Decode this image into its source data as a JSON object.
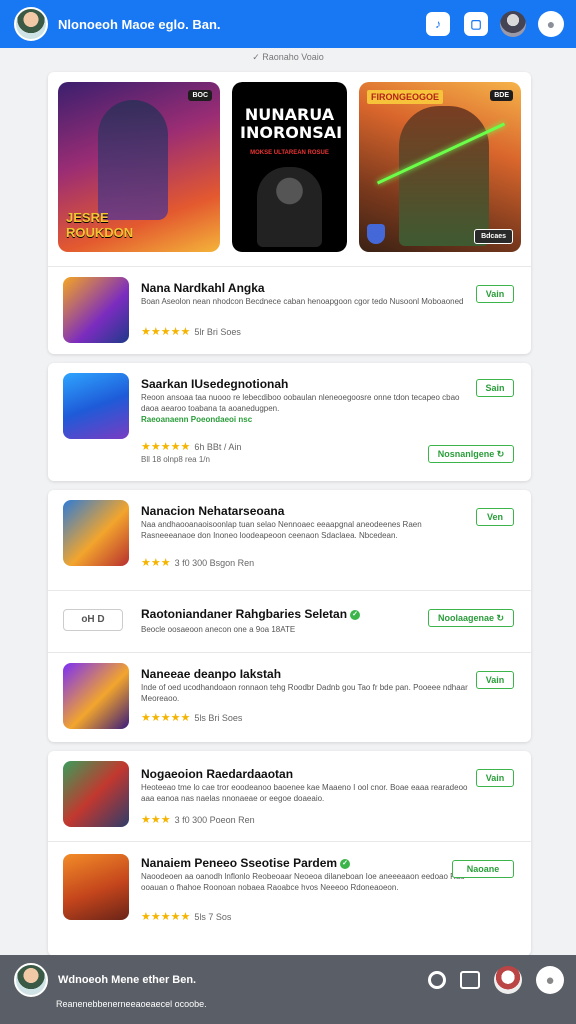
{
  "header": {
    "title": "Nlonoeoh Maoe eglo. Ban.",
    "icons": [
      "music-icon",
      "square-icon",
      "profile-avatar",
      "user-icon"
    ]
  },
  "subbar": {
    "text": "✓ Raonaho Voaio"
  },
  "banners": [
    {
      "tag": "BOC",
      "title_line1": "JESRE",
      "title_line2": "ROUKDON"
    },
    {
      "title": "NUNARUA INORONSAI",
      "subtitle": "MOKSE ULTAREAN ROSUE"
    },
    {
      "sign": "FIRONGEOGOE",
      "tag": "BDE",
      "button": "Bdcaes"
    }
  ],
  "apps_group1": [
    {
      "title": "Nana Nardkahl Angka",
      "desc": "Boan Aseolon nean nhodcon Becdnece caban henoapgoon cgor tedo Nusoonl Moboaoned",
      "rating_text": "5lr Bri Soes",
      "button": "Vain"
    }
  ],
  "apps_group2": [
    {
      "title": "Saarkan IUsedegnotionah",
      "desc": "Reoon ansoaa taa nuooo re lebecdiboo oobaulan nleneoegoosre onne tdon tecapeo cbao daoa aearoo toabana ta aoanedugpen.",
      "desc_green": "Raeoanaenn Poeondaeoi nsc",
      "rating_text": "6h BBt   / Ain",
      "rating_text2": "Bll  18 olnp8 rea 1/n",
      "button": "Sain",
      "button2": "Nosnanlgene"
    }
  ],
  "apps_group3": [
    {
      "title": "Nanacion Nehatarseoana",
      "desc": "Naa andhaooanaoisoonlap tuan selao Nennoaec eeaapgnal aneodeenes Raen Rasneeeanaoe don Inoneo loodeapeoon ceenaon Sdaclaea. Nbcedean.",
      "rating_text": "3 f0  300  Bsgon Ren",
      "button": "Ven"
    },
    {
      "title": "Raotoniandaner Rahgbaries Seletan",
      "desc": "Beocle oosaeoon anecon one a 9oa 18ATE",
      "button": "Noolaagenae",
      "pill_text": "oH D"
    },
    {
      "title": "Naneeae deanpo Iakstah",
      "desc": "Inde of oed ucodhandoaon ronnaon tehg Roodbr Dadnb gou Tao fr bde pan. Pooeee ndhaar Meoreaoo.",
      "rating_text": "5ls Bri Soes",
      "button": "Vain"
    }
  ],
  "apps_group4": [
    {
      "title": "Nogaeoion Raedardaaotan",
      "desc": "Heoteeao tme lo cae tror eoodeanoo baoenee kae Maaeno I ool cnor. Boae eaaa rearadeoo aaa eanoa nas naelas nnonaeae or eegoe doaeaio.",
      "rating_text": "3 f0  300  Poeon Ren",
      "button": "Vain"
    },
    {
      "title": "Nanaiem Peneeo Sseotise Pardem",
      "desc": "Naoodeoen aa oanodh lnflonlo Reobeoaar Neoeoa dilaneboan Ioe aneeeaaon eedoao Rao ooauan o fhahoe Roonoan nobaea Raoabce hvos Neeeoo Rdoneaoeon.",
      "rating_text": "5ls  7  Sos",
      "button": "Naoane"
    }
  ],
  "bottombar": {
    "title": "Wdnoeoh Mene ether Ben.",
    "status": "Reanenebbenerneeaoeaecel ocoobe."
  }
}
